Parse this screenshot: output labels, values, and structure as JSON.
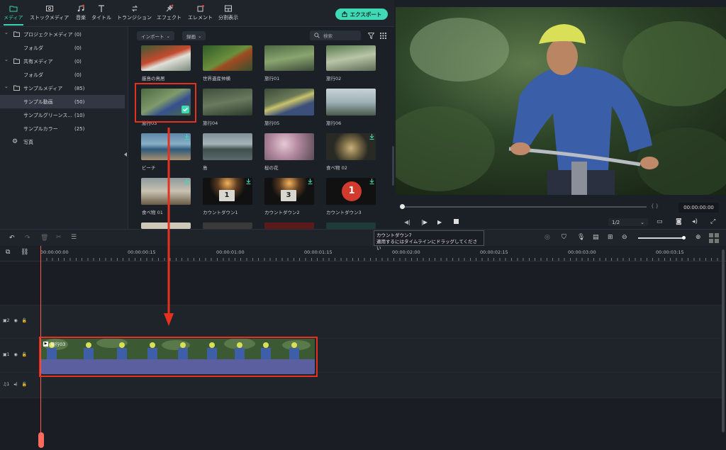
{
  "toolbar": {
    "tabs": [
      {
        "label": "メディア",
        "icon": "folder-icon"
      },
      {
        "label": "ストックメディア",
        "icon": "stock-media-icon"
      },
      {
        "label": "音楽",
        "icon": "music-note-icon"
      },
      {
        "label": "タイトル",
        "icon": "title-text-icon"
      },
      {
        "label": "トランジション",
        "icon": "transition-icon"
      },
      {
        "label": "エフェクト",
        "icon": "effects-icon"
      },
      {
        "label": "エレメント",
        "icon": "elements-icon"
      },
      {
        "label": "分割表示",
        "icon": "split-screen-icon"
      }
    ],
    "export_label": "エクスポート",
    "accent_color": "#38d3b4"
  },
  "tree": {
    "items": [
      {
        "label": "プロジェクトメディア",
        "count": "(0)"
      },
      {
        "label": "フォルダ",
        "count": "(0)"
      },
      {
        "label": "共有メディア",
        "count": "(0)"
      },
      {
        "label": "フォルダ",
        "count": "(0)"
      },
      {
        "label": "サンプルメディア",
        "count": "(85)"
      },
      {
        "label": "サンプル動画",
        "count": "(50)"
      },
      {
        "label": "サンプルグリーンス...",
        "count": "(10)"
      },
      {
        "label": "サンプルカラー",
        "count": "(25)"
      },
      {
        "label": "写真",
        "count": ""
      }
    ]
  },
  "media": {
    "import_label": "インポート",
    "sort_label": "録画",
    "search_placeholder": "検索",
    "captions": [
      "厳島の鳥居",
      "世界遺産仲横",
      "旅行01",
      "旅行02",
      "旅行03",
      "旅行04",
      "旅行05",
      "旅行06",
      "ビーチ",
      "島",
      "桜の花",
      "食べ物 02",
      "食べ物 01",
      "カウントダウン1",
      "カウントダウン2",
      "カウントダウン3"
    ]
  },
  "tooltip": {
    "line1": "カウントダウン7",
    "line2": "適用するにはタイムラインにドラッグしてください"
  },
  "preview": {
    "brackets": "{   }",
    "timecode": "00:00:00:00",
    "quality": "1/2"
  },
  "timeline": {
    "ruler": [
      "00:00:00:00",
      "00:00:00:15",
      "00:00:01:00",
      "00:00:01:15",
      "00:00:02:00",
      "00:00:02:15",
      "00:00:03:00",
      "00:00:03:15"
    ],
    "track_labels": [
      "2",
      "1",
      "1"
    ],
    "clip_label": "旅行03"
  }
}
